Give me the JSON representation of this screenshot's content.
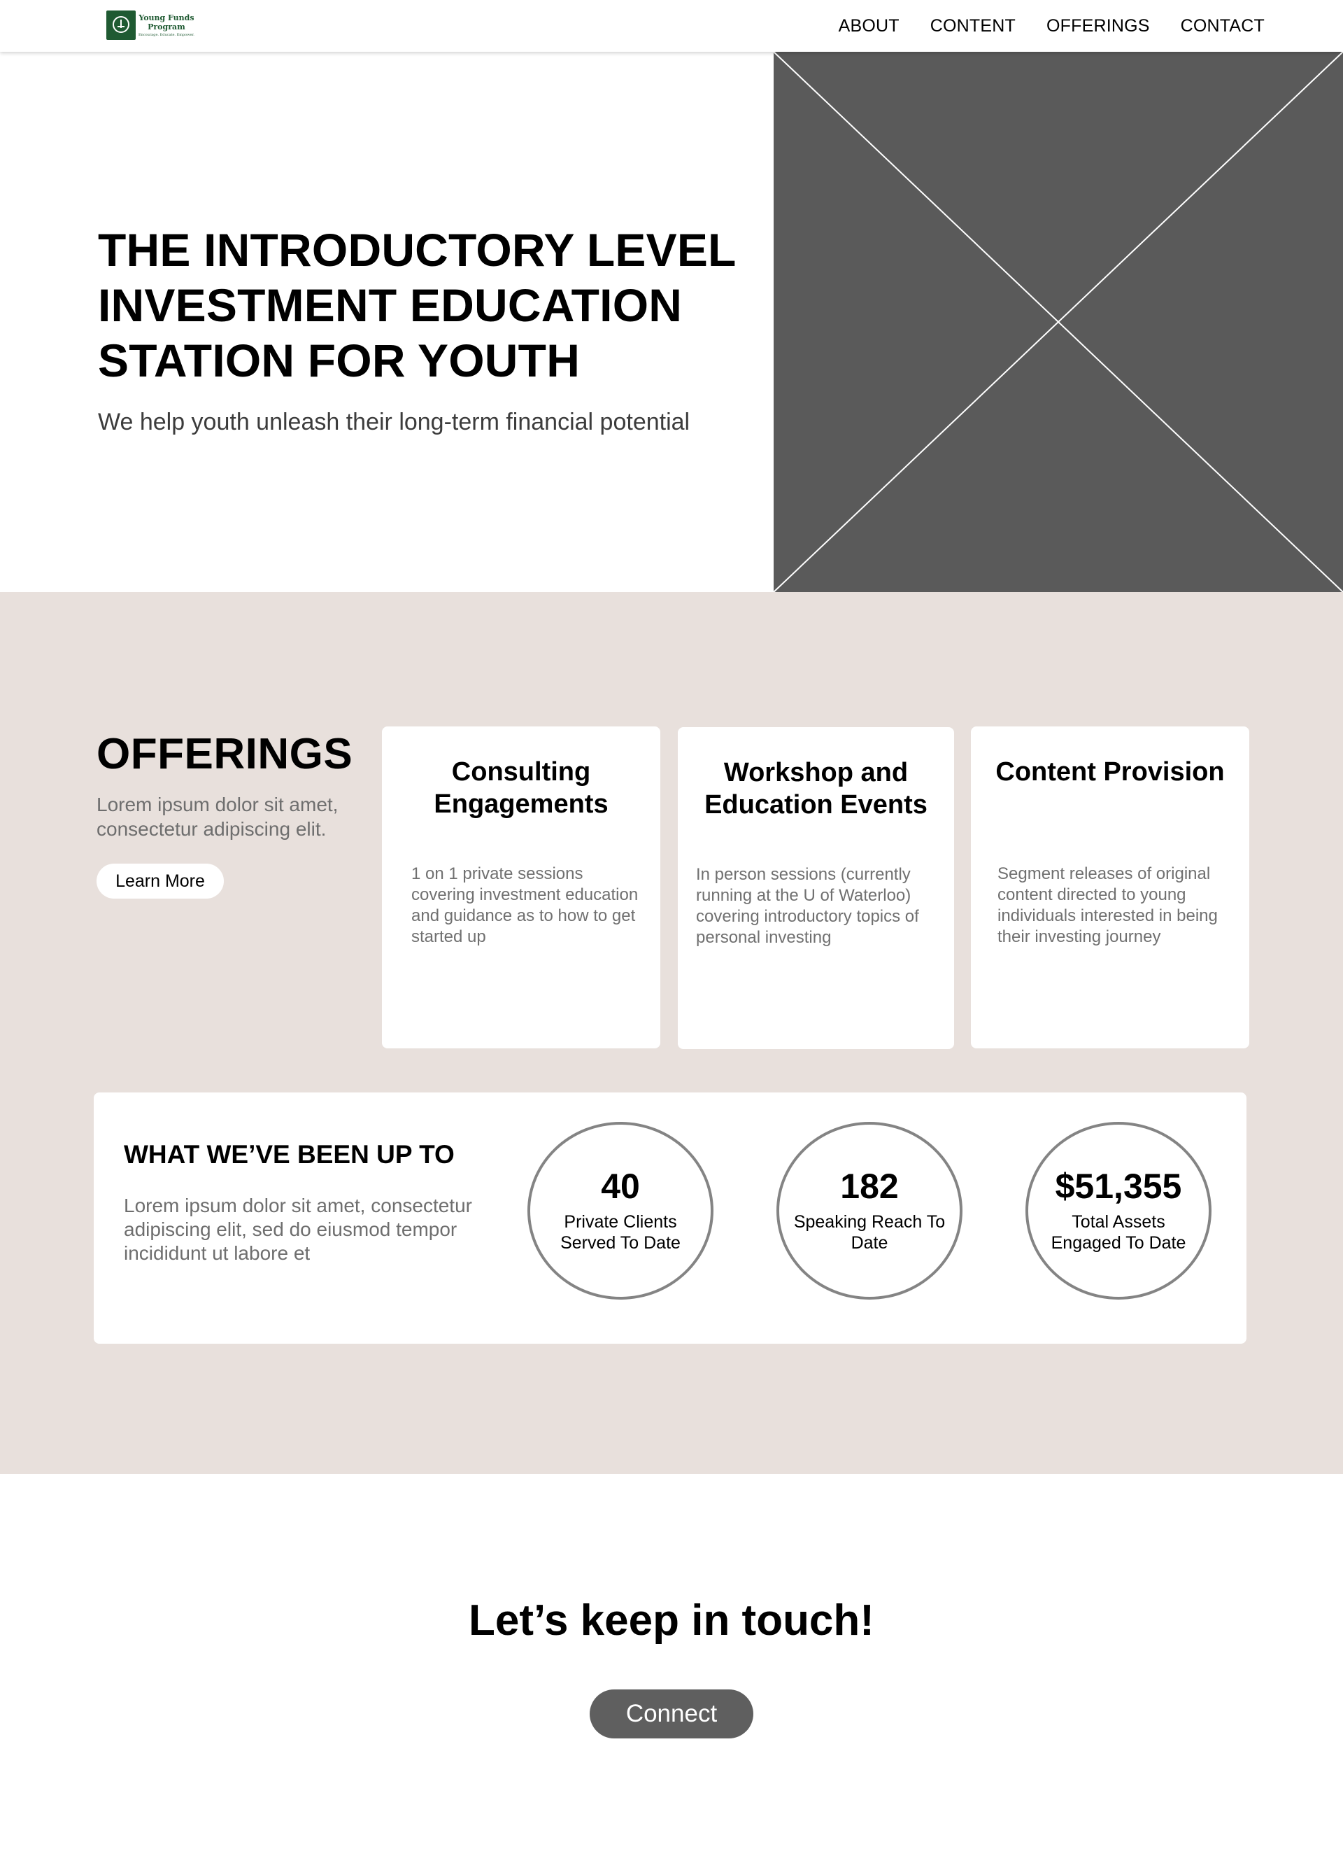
{
  "header": {
    "logo": {
      "line1": "Young Funds",
      "line2": "Program",
      "tagline": "Encourage. Educate. Empower."
    },
    "nav": [
      {
        "label": "ABOUT"
      },
      {
        "label": "CONTENT"
      },
      {
        "label": "OFFERINGS"
      },
      {
        "label": "CONTACT"
      }
    ]
  },
  "hero": {
    "title": "THE INTRODUCTORY LEVEL INVESTMENT EDUCATION STATION FOR YOUTH",
    "subtitle": "We help youth unleash their long-term financial potential",
    "image_color": "#5a5a5a"
  },
  "offerings": {
    "title": "OFFERINGS",
    "description": "Lorem ipsum dolor sit amet, consectetur adipiscing elit.",
    "cta_label": "Learn More",
    "cards": [
      {
        "title": "Consulting Engagements",
        "body": "1 on 1 private sessions covering investment education and guidance as to how to get started up"
      },
      {
        "title": "Workshop and Education Events",
        "body": "In person sessions (currently running at the U of Waterloo) covering introductory topics of personal investing"
      },
      {
        "title": "Content Provision",
        "body": "Segment releases of original content directed to young individuals interested in being their investing journey"
      }
    ]
  },
  "stats": {
    "title": "WHAT WE’VE BEEN UP TO",
    "description": "Lorem ipsum dolor sit amet, consectetur adipiscing elit, sed do eiusmod tempor incididunt ut labore et",
    "items": [
      {
        "value": "40",
        "label": "Private Clients Served To Date"
      },
      {
        "value": "182",
        "label": "Speaking Reach To Date"
      },
      {
        "value": "$51,355",
        "label": "Total Assets Engaged To Date"
      }
    ]
  },
  "contact": {
    "title": "Let’s keep in touch!",
    "button_label": "Connect"
  },
  "colors": {
    "band_background": "#e8e0dc",
    "brand_green": "#1f5a32",
    "button_dark": "#5f5f5f"
  }
}
